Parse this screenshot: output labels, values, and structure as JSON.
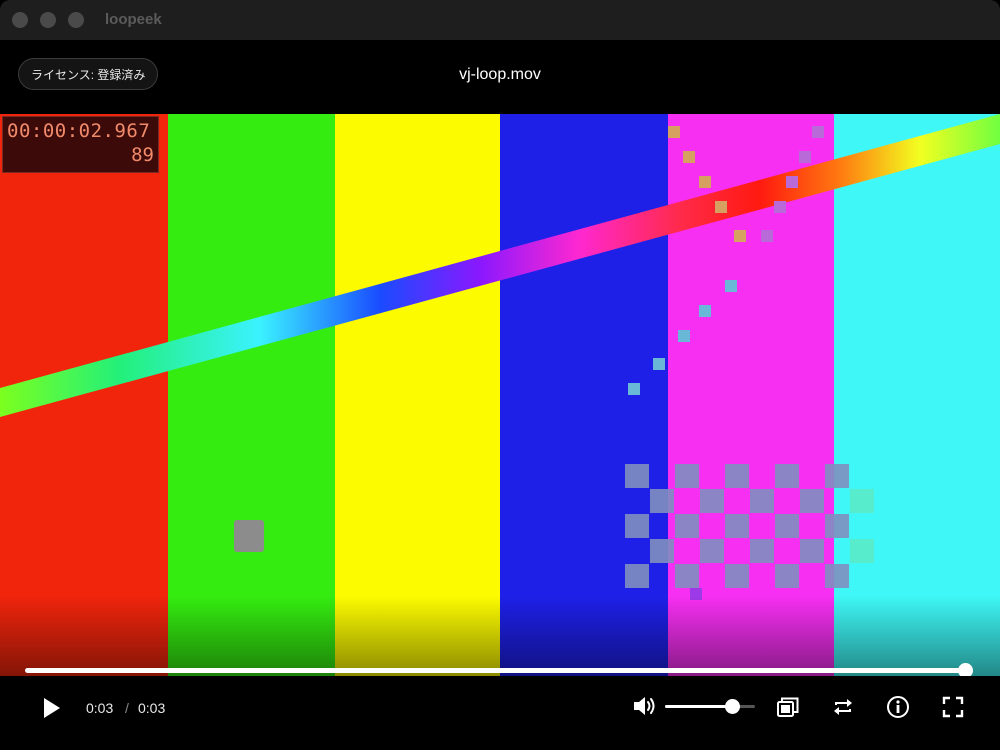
{
  "app": {
    "title": "loopeek"
  },
  "header": {
    "license_label": "ライセンス: 登録済み",
    "video_title": "vj-loop.mov"
  },
  "overlay": {
    "timecode": "00:00:02.967",
    "frame": "89"
  },
  "player": {
    "current_time": "0:03",
    "separator": "/",
    "duration": "0:03",
    "progress": 1.0,
    "volume": 0.75
  },
  "icons": [
    "play-icon",
    "volume-icon",
    "pip-icon",
    "loop-icon",
    "info-icon",
    "fullscreen-icon"
  ],
  "colors": {
    "bar_red": "#f0250c",
    "bar_green": "#34ec10",
    "bar_yellow": "#fcfb00",
    "bar_blue": "#1e20e8",
    "bar_magenta": "#f62ff2",
    "bar_cyan": "#3ef7f6"
  }
}
